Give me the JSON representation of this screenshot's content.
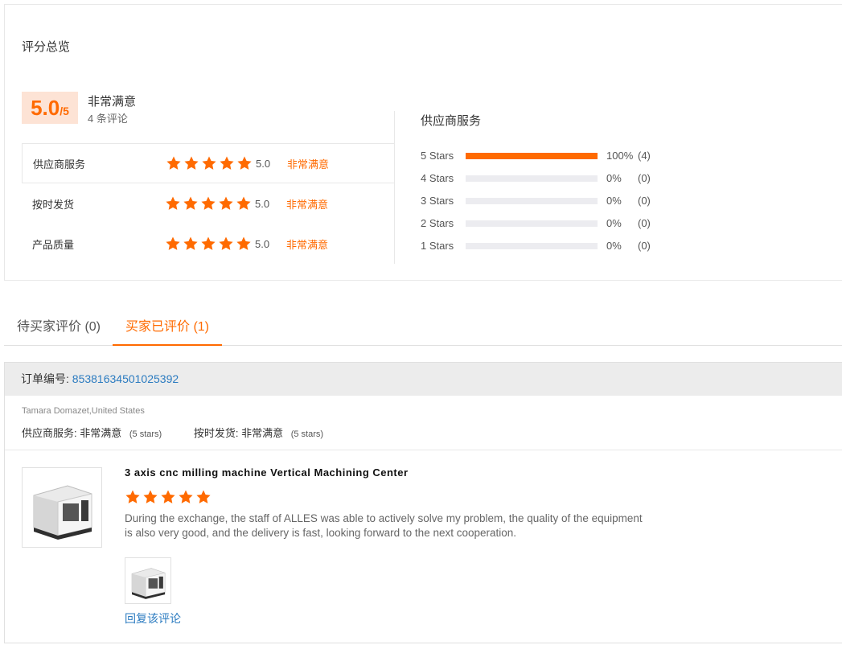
{
  "summary": {
    "title": "评分总览",
    "score": "5.0",
    "score_max": "/5",
    "score_word": "非常满意",
    "review_count": "4 条评论",
    "dimensions": [
      {
        "label": "供应商服务",
        "value": "5.0",
        "word": "非常满意",
        "stars": 5
      },
      {
        "label": "按时发货",
        "value": "5.0",
        "word": "非常满意",
        "stars": 5
      },
      {
        "label": "产品质量",
        "value": "5.0",
        "word": "非常满意",
        "stars": 5
      }
    ],
    "supplier_title": "供应商服务",
    "distribution": [
      {
        "label": "5  Stars",
        "pct": "100%",
        "count": "(4)",
        "fraction": 1.0
      },
      {
        "label": "4  Stars",
        "pct": "0%",
        "count": "(0)",
        "fraction": 0
      },
      {
        "label": "3  Stars",
        "pct": "0%",
        "count": "(0)",
        "fraction": 0
      },
      {
        "label": "2  Stars",
        "pct": "0%",
        "count": "(0)",
        "fraction": 0
      },
      {
        "label": "1  Stars",
        "pct": "0%",
        "count": "(0)",
        "fraction": 0
      }
    ]
  },
  "tabs": [
    {
      "label": "待买家评价 (0)",
      "active": false
    },
    {
      "label": "买家已评价 (1)",
      "active": true
    }
  ],
  "review": {
    "order_label": "订单编号: ",
    "order_number": "85381634501025392",
    "buyer": "Tamara Domazet,United States",
    "supplier_label": "供应商服务: ",
    "supplier_word": "非常满意",
    "supplier_stars": "(5 stars)",
    "delivery_label": "按时发货: ",
    "delivery_word": "非常满意",
    "delivery_stars": "(5 stars)",
    "product_title": "3 axis cnc milling machine Vertical Machining Center",
    "rating": 5,
    "text": "During the exchange, the staff of ALLES was able to actively solve my problem, the quality of the equipment is also very good, and the delivery is fast, looking forward to the next cooperation.",
    "reply_link": "回复该评论"
  },
  "colors": {
    "accent": "#ff6a00",
    "link": "#2b7bc0"
  },
  "icons": {
    "star": "star-icon"
  }
}
